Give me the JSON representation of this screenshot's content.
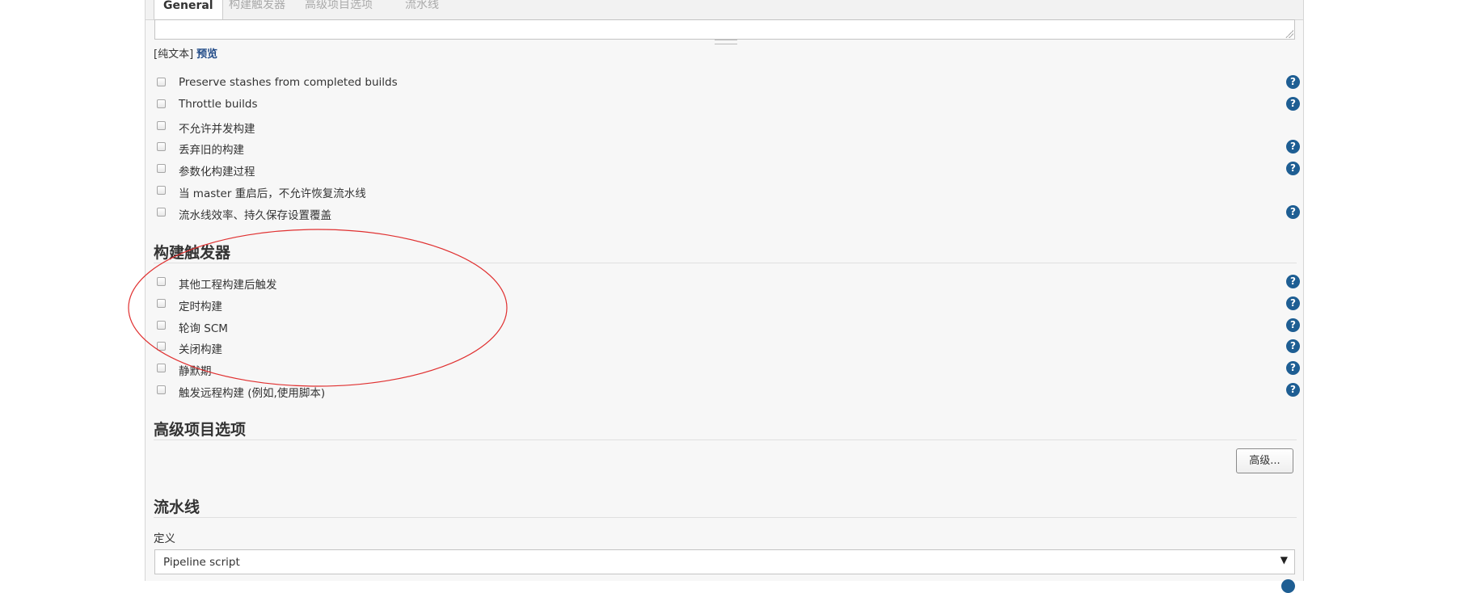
{
  "tabs": [
    {
      "label": "General",
      "active": true
    },
    {
      "label": "构建触发器",
      "active": false
    },
    {
      "label": "高级项目选项",
      "active": false
    },
    {
      "label": "流水线",
      "active": false
    }
  ],
  "description": {
    "format_label": "[纯文本]",
    "preview_link": "预览"
  },
  "general_options": [
    {
      "label": "Preserve stashes from completed builds",
      "help": true
    },
    {
      "label": "Throttle builds",
      "help": true
    },
    {
      "label": "不允许并发构建",
      "help": false
    },
    {
      "label": "丢弃旧的构建",
      "help": true
    },
    {
      "label": "参数化构建过程",
      "help": true
    },
    {
      "label": "当 master 重启后，不允许恢复流水线",
      "help": false
    },
    {
      "label": "流水线效率、持久保存设置覆盖",
      "help": true
    }
  ],
  "triggers": {
    "title": "构建触发器",
    "options": [
      {
        "label": "其他工程构建后触发",
        "help": true
      },
      {
        "label": "定时构建",
        "help": true
      },
      {
        "label": "轮询 SCM",
        "help": true
      },
      {
        "label": "关闭构建",
        "help": true
      },
      {
        "label": "静默期",
        "help": true
      },
      {
        "label": "触发远程构建 (例如,使用脚本)",
        "help": true
      }
    ]
  },
  "advanced": {
    "title": "高级项目选项",
    "button_label": "高级..."
  },
  "pipeline": {
    "title": "流水线",
    "definition_label": "定义",
    "definition_value": "Pipeline script"
  },
  "icons": {
    "help": "help-icon",
    "select_arrow": "▼"
  },
  "colors": {
    "help_icon": "#1e5e93",
    "annotation": "#e03030",
    "link": "#204a87"
  }
}
